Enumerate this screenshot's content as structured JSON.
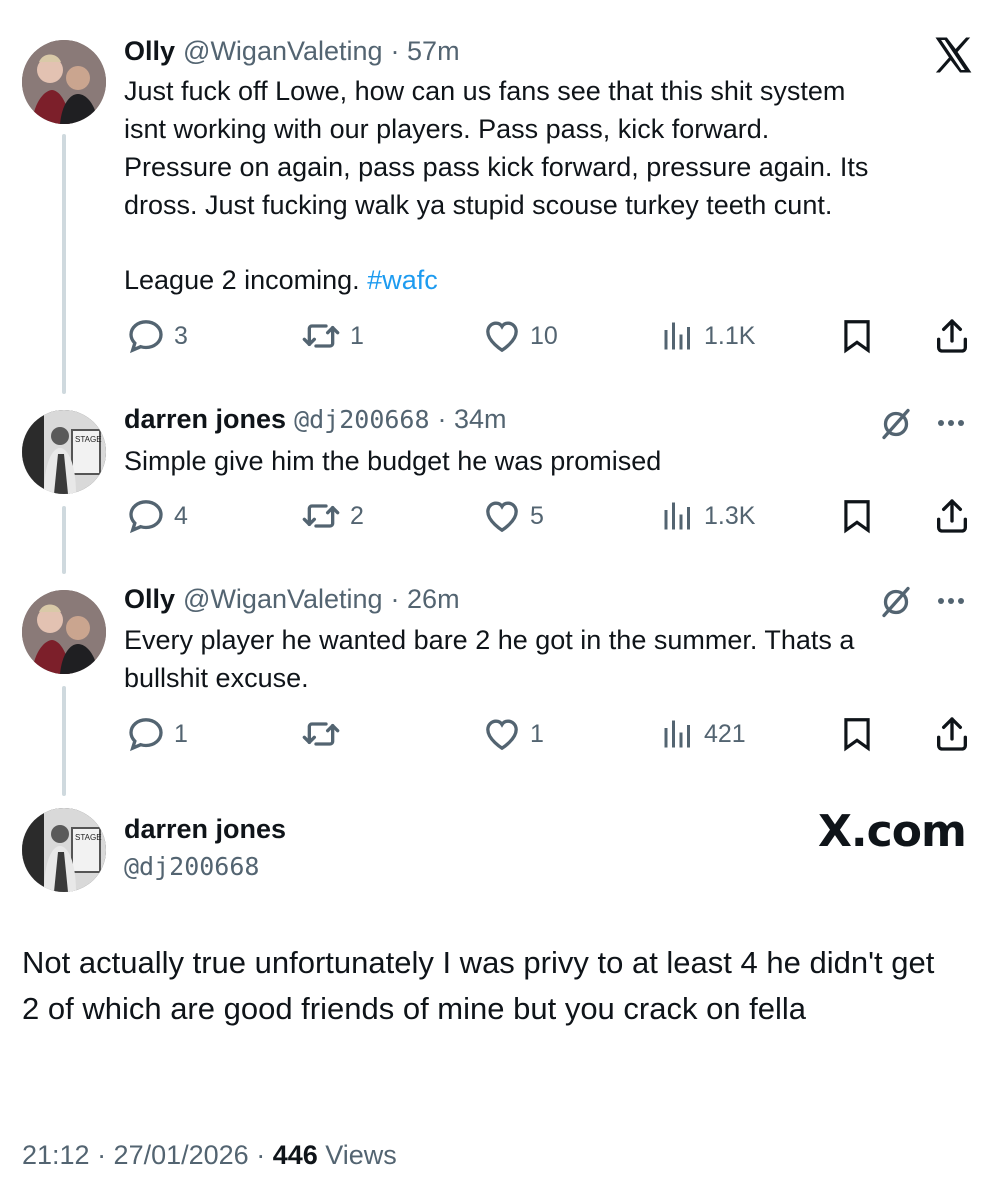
{
  "tweets": [
    {
      "name": "Olly",
      "handle": "@WiganValeting",
      "time": "· 57m",
      "text_lines": [
        "Just fuck off Lowe, how can us fans see that this shit system",
        "isnt working with our players. Pass pass, kick forward.",
        "Pressure on again, pass pass kick forward, pressure again. Its",
        "dross. Just fucking walk ya stupid scouse turkey teeth cunt."
      ],
      "last_line_text": "League 2 incoming.",
      "hashtag": "#wafc",
      "replies": "3",
      "retweets": "1",
      "likes": "10",
      "views": "1.1K"
    },
    {
      "name": "darren jones",
      "handle": "@dj200668",
      "time": "· 34m",
      "text": "Simple give him the budget he was promised",
      "replies": "4",
      "retweets": "2",
      "likes": "5",
      "views": "1.3K"
    },
    {
      "name": "Olly",
      "handle": "@WiganValeting",
      "time": "· 26m",
      "text_lines": [
        "Every player he wanted bare 2 he got in the summer. Thats a",
        "bullshit excuse."
      ],
      "replies": "1",
      "retweets": "",
      "likes": "1",
      "views": "421"
    }
  ],
  "main_tweet": {
    "name": "darren jones",
    "handle": "@dj200668",
    "brand": "X.com",
    "text": "Not actually true unfortunately I was privy to at least 4 he didn't get 2  of which are good friends of mine but you crack on fella",
    "timestamp": "21:12 · 27/01/2026 · ",
    "views_count": "446",
    "views_label": " Views"
  },
  "icons": {
    "close": "x-logo-icon",
    "reply": "reply-icon",
    "retweet": "retweet-icon",
    "like": "heart-icon",
    "views": "views-icon",
    "bookmark": "bookmark-icon",
    "share": "share-icon",
    "grok": "grok-icon",
    "more": "more-icon"
  },
  "colors": {
    "text": "#0f1419",
    "muted": "#536471",
    "link": "#1d9bf0",
    "thread": "#cfd9de"
  }
}
